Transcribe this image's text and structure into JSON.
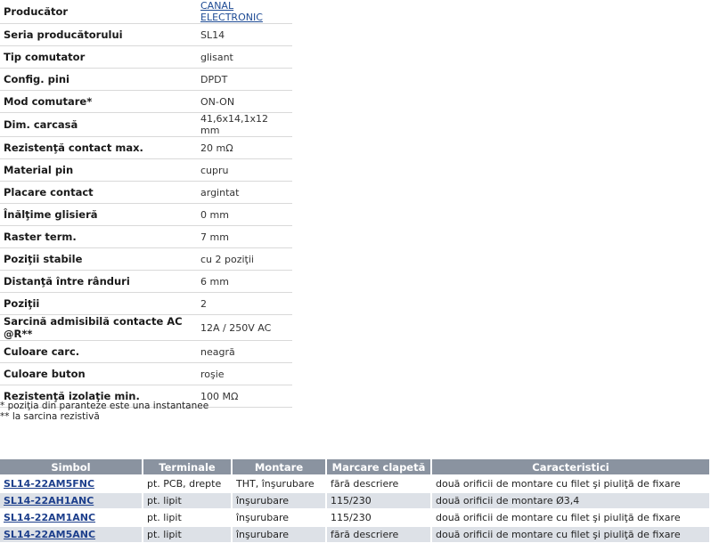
{
  "specs": [
    {
      "label": "Producător",
      "value": "CANAL ELECTRONIC",
      "link": true
    },
    {
      "label": "Seria producătorului",
      "value": "SL14"
    },
    {
      "label": "Tip comutator",
      "value": "glisant"
    },
    {
      "label": "Config. pini",
      "value": "DPDT"
    },
    {
      "label": "Mod comutare*",
      "value": "ON-ON"
    },
    {
      "label": "Dim. carcasă",
      "value": "41,6x14,1x12 mm"
    },
    {
      "label": "Rezistenţă contact max.",
      "value": "20 mΩ"
    },
    {
      "label": "Material pin",
      "value": "cupru"
    },
    {
      "label": "Placare contact",
      "value": "argintat"
    },
    {
      "label": "Înălţime glisieră",
      "value": "0 mm"
    },
    {
      "label": "Raster term.",
      "value": "7 mm"
    },
    {
      "label": "Poziţii stabile",
      "value": "cu 2 poziţii"
    },
    {
      "label": "Distanţă între rânduri",
      "value": "6 mm"
    },
    {
      "label": "Poziţii",
      "value": "2"
    },
    {
      "label": "Sarcină admisibilă contacte AC @R**",
      "value": "12A / 250V AC"
    },
    {
      "label": "Culoare carc.",
      "value": "neagră"
    },
    {
      "label": "Culoare buton",
      "value": "roşie"
    },
    {
      "label": "Rezistenţă izolaţie min.",
      "value": "100 MΩ"
    }
  ],
  "notes": {
    "note1": "* poziţia din paranteze este una instantanee",
    "note2": "** la sarcina rezistivă"
  },
  "products": {
    "headers": [
      "Simbol",
      "Terminale",
      "Montare",
      "Marcare clapetă",
      "Caracteristici"
    ],
    "rows": [
      [
        "SL14-22AM5FNC",
        "pt. PCB, drepte",
        "THT, înşurubare",
        "fără descriere",
        "două orificii de montare cu filet şi piuliţă de fixare"
      ],
      [
        "SL14-22AH1ANC",
        "pt. lipit",
        "înşurubare",
        "115/230",
        "două orificii de montare Ø3,4"
      ],
      [
        "SL14-22AM1ANC",
        "pt. lipit",
        "înşurubare",
        "115/230",
        "două orificii de montare cu filet şi piuliţă de fixare"
      ],
      [
        "SL14-22AM5ANC",
        "pt. lipit",
        "înşurubare",
        "fără descriere",
        "două orificii de montare cu filet şi piuliţă de fixare"
      ]
    ]
  },
  "colors": {
    "header_bg": "#8a93a0",
    "row_alt_bg": "#dde1e7",
    "link": "#1d3f8c"
  }
}
